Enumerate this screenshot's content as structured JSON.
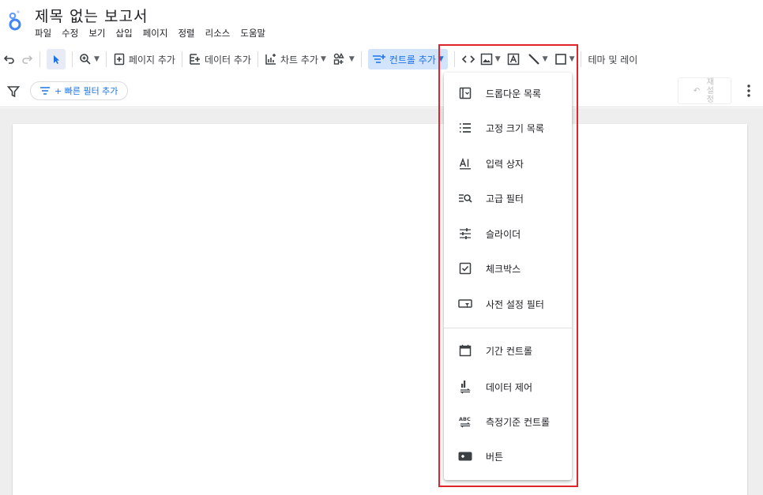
{
  "app": {
    "title": "제목 없는 보고서",
    "menu": [
      "파일",
      "수정",
      "보기",
      "삽입",
      "페이지",
      "정렬",
      "리소스",
      "도움말"
    ]
  },
  "toolbar": {
    "add_page": "페이지 추가",
    "add_data": "데이터 추가",
    "add_chart": "차트 추가",
    "add_control": "컨트롤 추가",
    "theme_layout": "테마 및 레이"
  },
  "filterbar": {
    "quick_filter": "+ 빠른 필터 추가",
    "reset": "재설정"
  },
  "dropdown": {
    "items": [
      {
        "label": "드롭다운 목록",
        "icon": "dropdown-list-icon"
      },
      {
        "label": "고정 크기 목록",
        "icon": "list-icon"
      },
      {
        "label": "입력 상자",
        "icon": "text-input-icon"
      },
      {
        "label": "고급 필터",
        "icon": "advanced-filter-icon"
      },
      {
        "label": "슬라이더",
        "icon": "slider-icon"
      },
      {
        "label": "체크박스",
        "icon": "checkbox-icon"
      },
      {
        "label": "사전 설정 필터",
        "icon": "preset-filter-icon"
      },
      {
        "label": "기간 컨트롤",
        "icon": "calendar-icon"
      },
      {
        "label": "데이터 제어",
        "icon": "data-control-icon"
      },
      {
        "label": "측정기준 컨트롤",
        "icon": "dimension-control-icon"
      },
      {
        "label": "버튼",
        "icon": "button-icon"
      }
    ]
  },
  "colors": {
    "accent": "#1a73e8",
    "highlight_outline": "#e0242b",
    "canvas_bg": "#eeeeee"
  }
}
